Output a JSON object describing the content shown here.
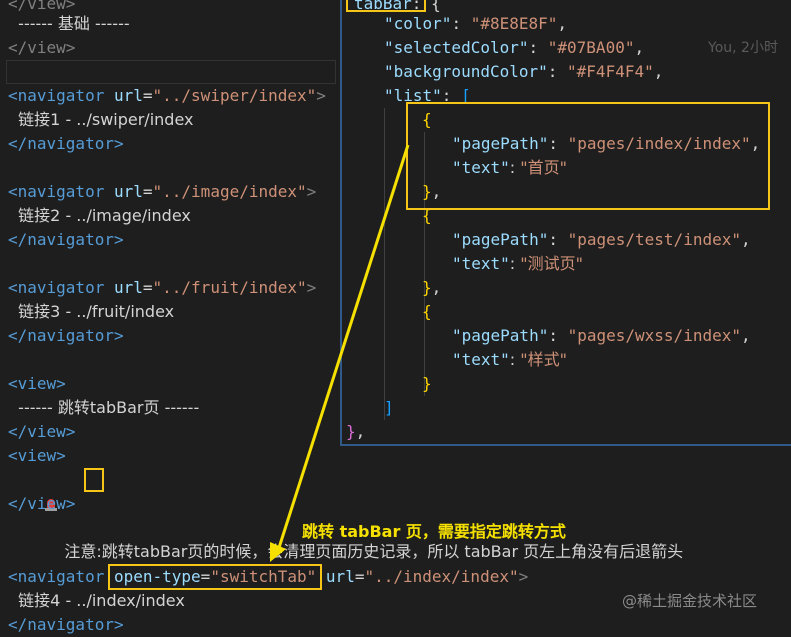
{
  "left_code": {
    "l0": "</view>",
    "l1_text": "  ------ 基础 ------",
    "l2": "</view>",
    "nav1": {
      "open_tag": "<navigator",
      "attr": "url",
      "val": "\"../swiper/index\"",
      "close": ">",
      "text": "  链接1 - ../swiper/index",
      "end": "</navigator>"
    },
    "nav2": {
      "open_tag": "<navigator",
      "attr": "url",
      "val": "\"../image/index\"",
      "close": ">",
      "text": "  链接2 - ../image/index",
      "end": "</navigator>"
    },
    "nav3": {
      "open_tag": "<navigator",
      "attr": "url",
      "val": "\"../fruit/index\"",
      "close": ">",
      "text": "  链接3 - ../fruit/index",
      "end": "</navigator>"
    },
    "view_open": "<view>",
    "view_text": "  ------ 跳转tabBar页 ------",
    "view_close": "</view>",
    "view2_open": "<view>",
    "note_prefix": "注意",
    "note_text": ":跳转tabBar页的时候，会清理页面历史记录，所以 tabBar 页左上角没有后退箭头",
    "view2_close": "</view>",
    "nav4": {
      "open_tag": "<navigator",
      "attr1": "open-type",
      "val1": "\"switchTab\"",
      "attr2": "url",
      "val2": "\"../index/index\"",
      "close": ">",
      "text": "  链接4 - ../index/index",
      "end": "</navigator>"
    }
  },
  "json_panel": {
    "top_key": "tabBar",
    "top_rest": ": {",
    "color_key": "\"color\"",
    "color_val": "\"#8E8E8F\"",
    "sel_key": "\"selectedColor\"",
    "sel_val": "\"#07BA00\"",
    "bg_key": "\"backgroundColor\"",
    "bg_val": "\"#F4F4F4\"",
    "list_key": "\"list\"",
    "items": [
      {
        "page_key": "\"pagePath\"",
        "page_val": "\"pages/index/index\"",
        "text_key": "\"text\"",
        "text_val": "\"首页\""
      },
      {
        "page_key": "\"pagePath\"",
        "page_val": "\"pages/test/index\"",
        "text_key": "\"text\"",
        "text_val": "\"测试页\""
      },
      {
        "page_key": "\"pagePath\"",
        "page_val": "\"pages/wxss/index\"",
        "text_key": "\"text\"",
        "text_val": "\"样式\""
      }
    ],
    "blame": "You, 2小时"
  },
  "annotation": "跳转 tabBar 页，需要指定跳转方式",
  "watermark": "@稀土掘金技术社区",
  "colors": {
    "highlight": "#f5c518",
    "annotation": "#f5e000",
    "arrow": "#f5e000"
  }
}
